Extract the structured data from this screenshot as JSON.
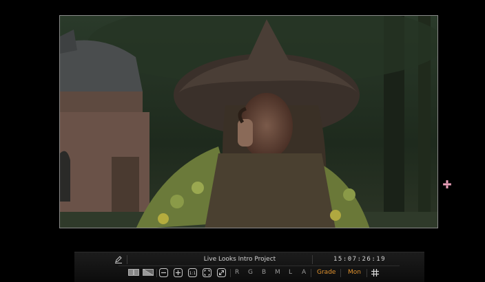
{
  "viewer": {
    "image_description_name": "video-frame"
  },
  "toolbar": {
    "project_title": "Live Looks Intro Project",
    "timecode": "15:07:26:19",
    "letters": [
      "R",
      "G",
      "B",
      "M",
      "L",
      "A"
    ],
    "grade_label": "Grade",
    "mon_label": "Mon"
  },
  "colors": {
    "accent": "#e2932e",
    "background": "#000000",
    "cursor": "#e8a0b8"
  }
}
